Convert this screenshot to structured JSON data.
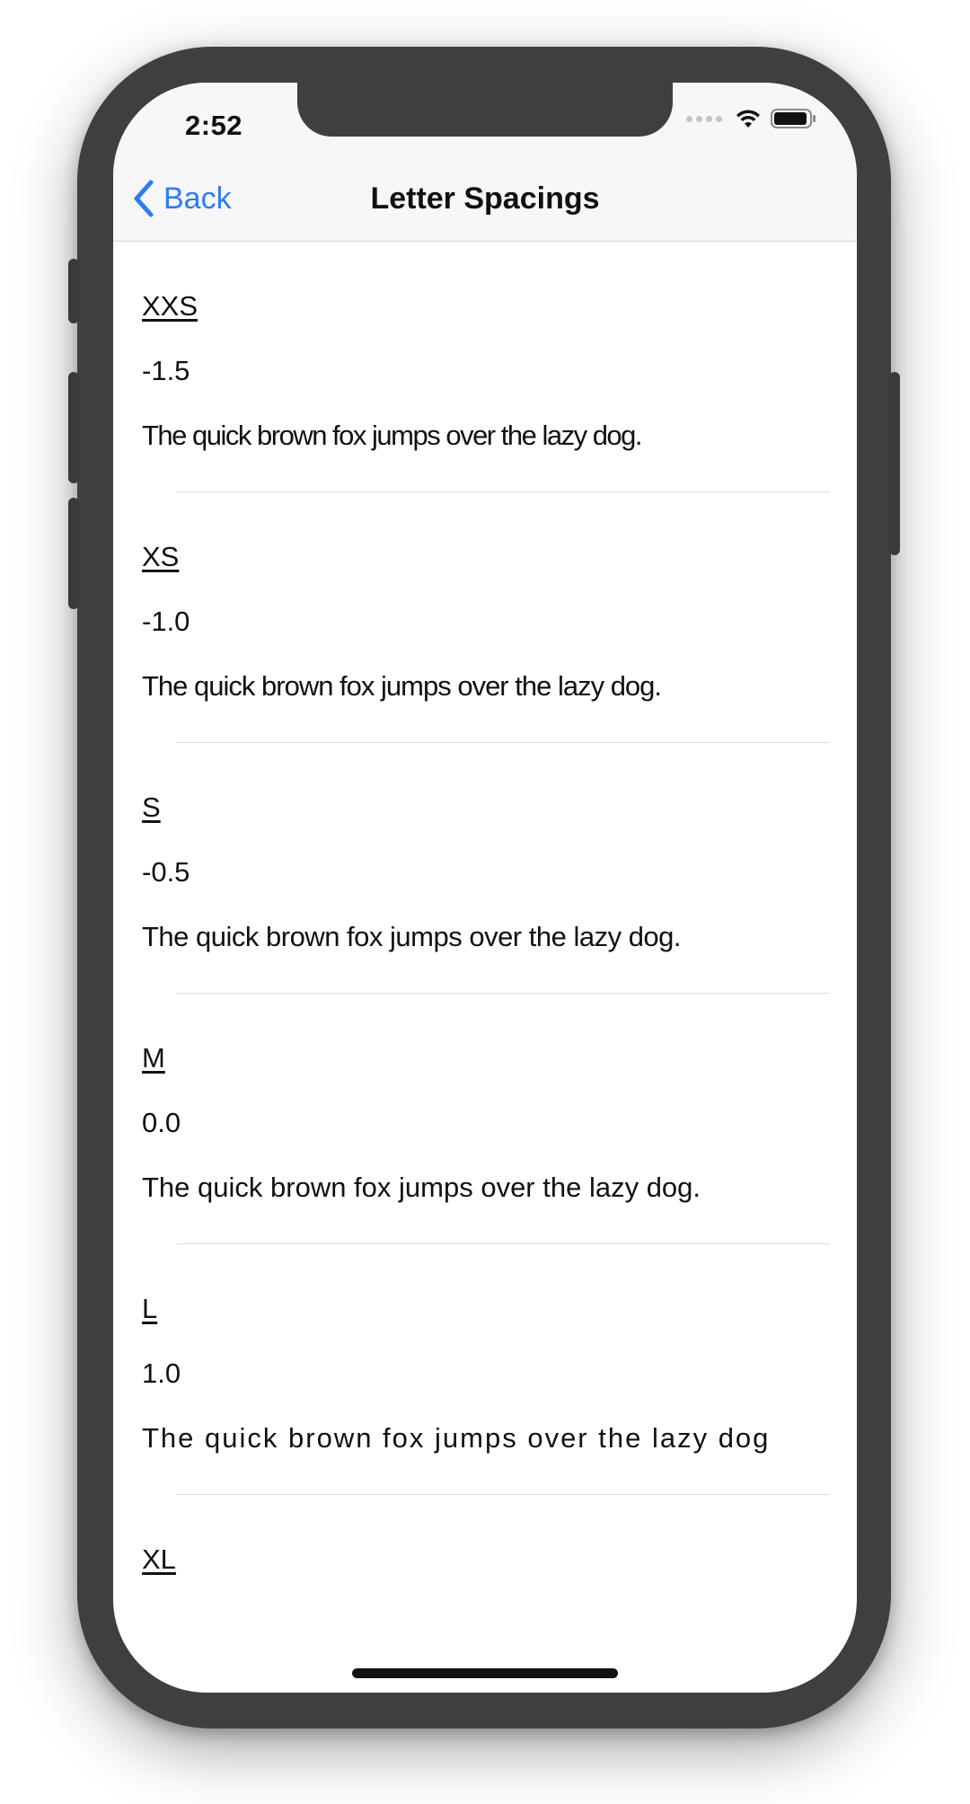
{
  "status_bar": {
    "time": "2:52",
    "icons": [
      "signal-dots-icon",
      "wifi-icon",
      "battery-icon"
    ]
  },
  "nav": {
    "back_label": "Back",
    "title": "Letter Spacings"
  },
  "colors": {
    "accent": "#2d7cf6",
    "text": "#111111",
    "separator": "#dedede",
    "navbar": "#f7f7f7"
  },
  "rows": [
    {
      "name": "XXS",
      "value": "-1.5",
      "sample": "The quick brown fox jumps over the lazy dog."
    },
    {
      "name": "XS",
      "value": "-1.0",
      "sample": "The quick brown fox jumps over the lazy dog."
    },
    {
      "name": "S",
      "value": "-0.5",
      "sample": "The quick brown fox jumps over the lazy dog."
    },
    {
      "name": "M",
      "value": "0.0",
      "sample": "The quick brown fox jumps over the lazy dog."
    },
    {
      "name": "L",
      "value": "1.0",
      "sample": "The quick brown fox jumps over the lazy dog"
    },
    {
      "name": "XL",
      "value": "",
      "sample": ""
    }
  ]
}
